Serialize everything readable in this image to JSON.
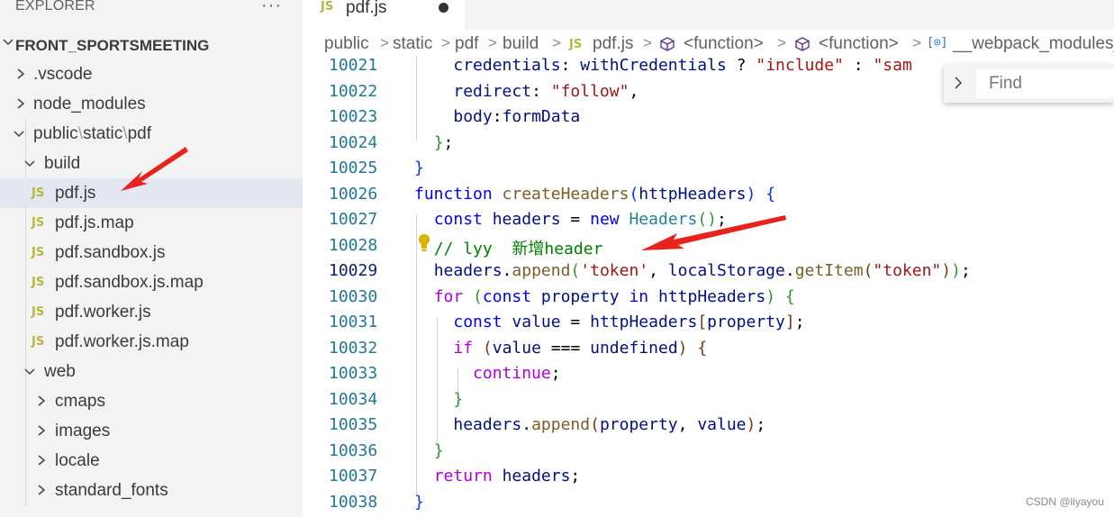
{
  "sidebar": {
    "title": "EXPLORER",
    "more": "···",
    "project": "FRONT_SPORTSMEETING",
    "items": [
      {
        "label": ".vscode",
        "type": "folder"
      },
      {
        "label": "node_modules",
        "type": "folder"
      },
      {
        "label": "public",
        "type": "folder-compact"
      },
      {
        "label": "build",
        "type": "folder"
      },
      {
        "label": "pdf.js",
        "type": "file"
      },
      {
        "label": "pdf.js.map",
        "type": "file"
      },
      {
        "label": "pdf.sandbox.js",
        "type": "file"
      },
      {
        "label": "pdf.sandbox.js.map",
        "type": "file"
      },
      {
        "label": "pdf.worker.js",
        "type": "file"
      },
      {
        "label": "pdf.worker.js.map",
        "type": "file"
      },
      {
        "label": "web",
        "type": "folder"
      },
      {
        "label": "cmaps",
        "type": "folder"
      },
      {
        "label": "images",
        "type": "folder"
      },
      {
        "label": "locale",
        "type": "folder"
      },
      {
        "label": "standard_fonts",
        "type": "folder"
      }
    ],
    "compact_parts": [
      "public",
      "static",
      "pdf"
    ],
    "compact_sep": "\\",
    "js_badge": "JS"
  },
  "tab": {
    "label": "pdf.js",
    "js_badge": "JS"
  },
  "breadcrumb": {
    "parts": [
      "public",
      "static",
      "pdf",
      "build",
      "pdf.js",
      "<function>",
      "<function>",
      "__webpack_modules_"
    ],
    "sep": ">",
    "var_icon": "[⊙]"
  },
  "find": {
    "placeholder": "Find"
  },
  "code": {
    "line_numbers": [
      "10021",
      "10022",
      "10023",
      "10024",
      "10025",
      "10026",
      "10027",
      "10028",
      "10029",
      "10030",
      "10031",
      "10032",
      "10033",
      "10034",
      "10035",
      "10036",
      "10037",
      "10038"
    ],
    "tokens": {
      "credentials": "credentials",
      "colon": ":",
      "withCredentials": "withCredentials",
      "question": "?",
      "include": "\"include\"",
      "sam": "\"sam",
      "redirect": "redirect",
      "follow": "\"follow\"",
      "comma": ",",
      "body": "body",
      "formData": "formData",
      "close_brace_semi_brace": "}",
      "semi": ";",
      "close_brace": "}",
      "function": "function",
      "createHeaders": "createHeaders",
      "lparen": "(",
      "rparen": ")",
      "httpHeaders": "httpHeaders",
      "open_brace": "{",
      "const": "const",
      "headers": "headers",
      "eq": "=",
      "new": "new",
      "Headers": "Headers",
      "empty_call": "()",
      "comment": "// lyy  新增header",
      "dot": ".",
      "append": "append",
      "token_str": "'token'",
      "localStorage": "localStorage",
      "getItem": "getItem",
      "token_dq": "\"token\"",
      "for": "for",
      "property": "property",
      "in": "in",
      "value": "value",
      "lbracket": "[",
      "rbracket": "]",
      "if": "if",
      "strict_eq": "===",
      "undefined": "undefined",
      "continue": "continue",
      "return": "return"
    }
  },
  "watermark": "CSDN @liyayou",
  "colors": {
    "arrow": "#e8231d",
    "sidebar_bg": "#f3f3f3",
    "selected_bg": "#e4e6f1",
    "line_number": "#237893"
  }
}
